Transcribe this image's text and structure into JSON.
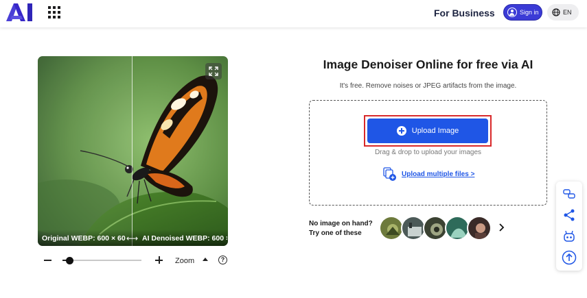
{
  "header": {
    "logo_icon": "ai-logo-icon",
    "apps_icon": "apps-grid-icon",
    "for_business": "For Business",
    "signin_label": "Sign in",
    "lang_label": "EN"
  },
  "preview": {
    "left_caption": "Original WEBP: 600 × 60...",
    "right_caption": "AI Denoised WEBP: 600 ×...",
    "compare_icon": "compare-arrows-icon",
    "expand_icon": "expand-icon"
  },
  "zoom": {
    "label": "Zoom",
    "help": "?",
    "slider_fraction": 0.09
  },
  "main": {
    "title": "Image Denoiser Online for free via AI",
    "subtitle": "It's free. Remove noises or JPEG artifacts from the image.",
    "upload_label": "Upload Image",
    "drag_text": "Drag & drop to upload your images",
    "multiple_link": "Upload multiple files >",
    "sample_label_line1": "No image on hand?",
    "sample_label_line2": "Try one of these"
  },
  "colors": {
    "primary": "#1f56e6",
    "signin": "#3b3bd6",
    "highlight": "#d8282a"
  },
  "floating_toolbar": [
    "feedback-icon",
    "share-icon",
    "bot-icon",
    "scroll-top-icon"
  ]
}
